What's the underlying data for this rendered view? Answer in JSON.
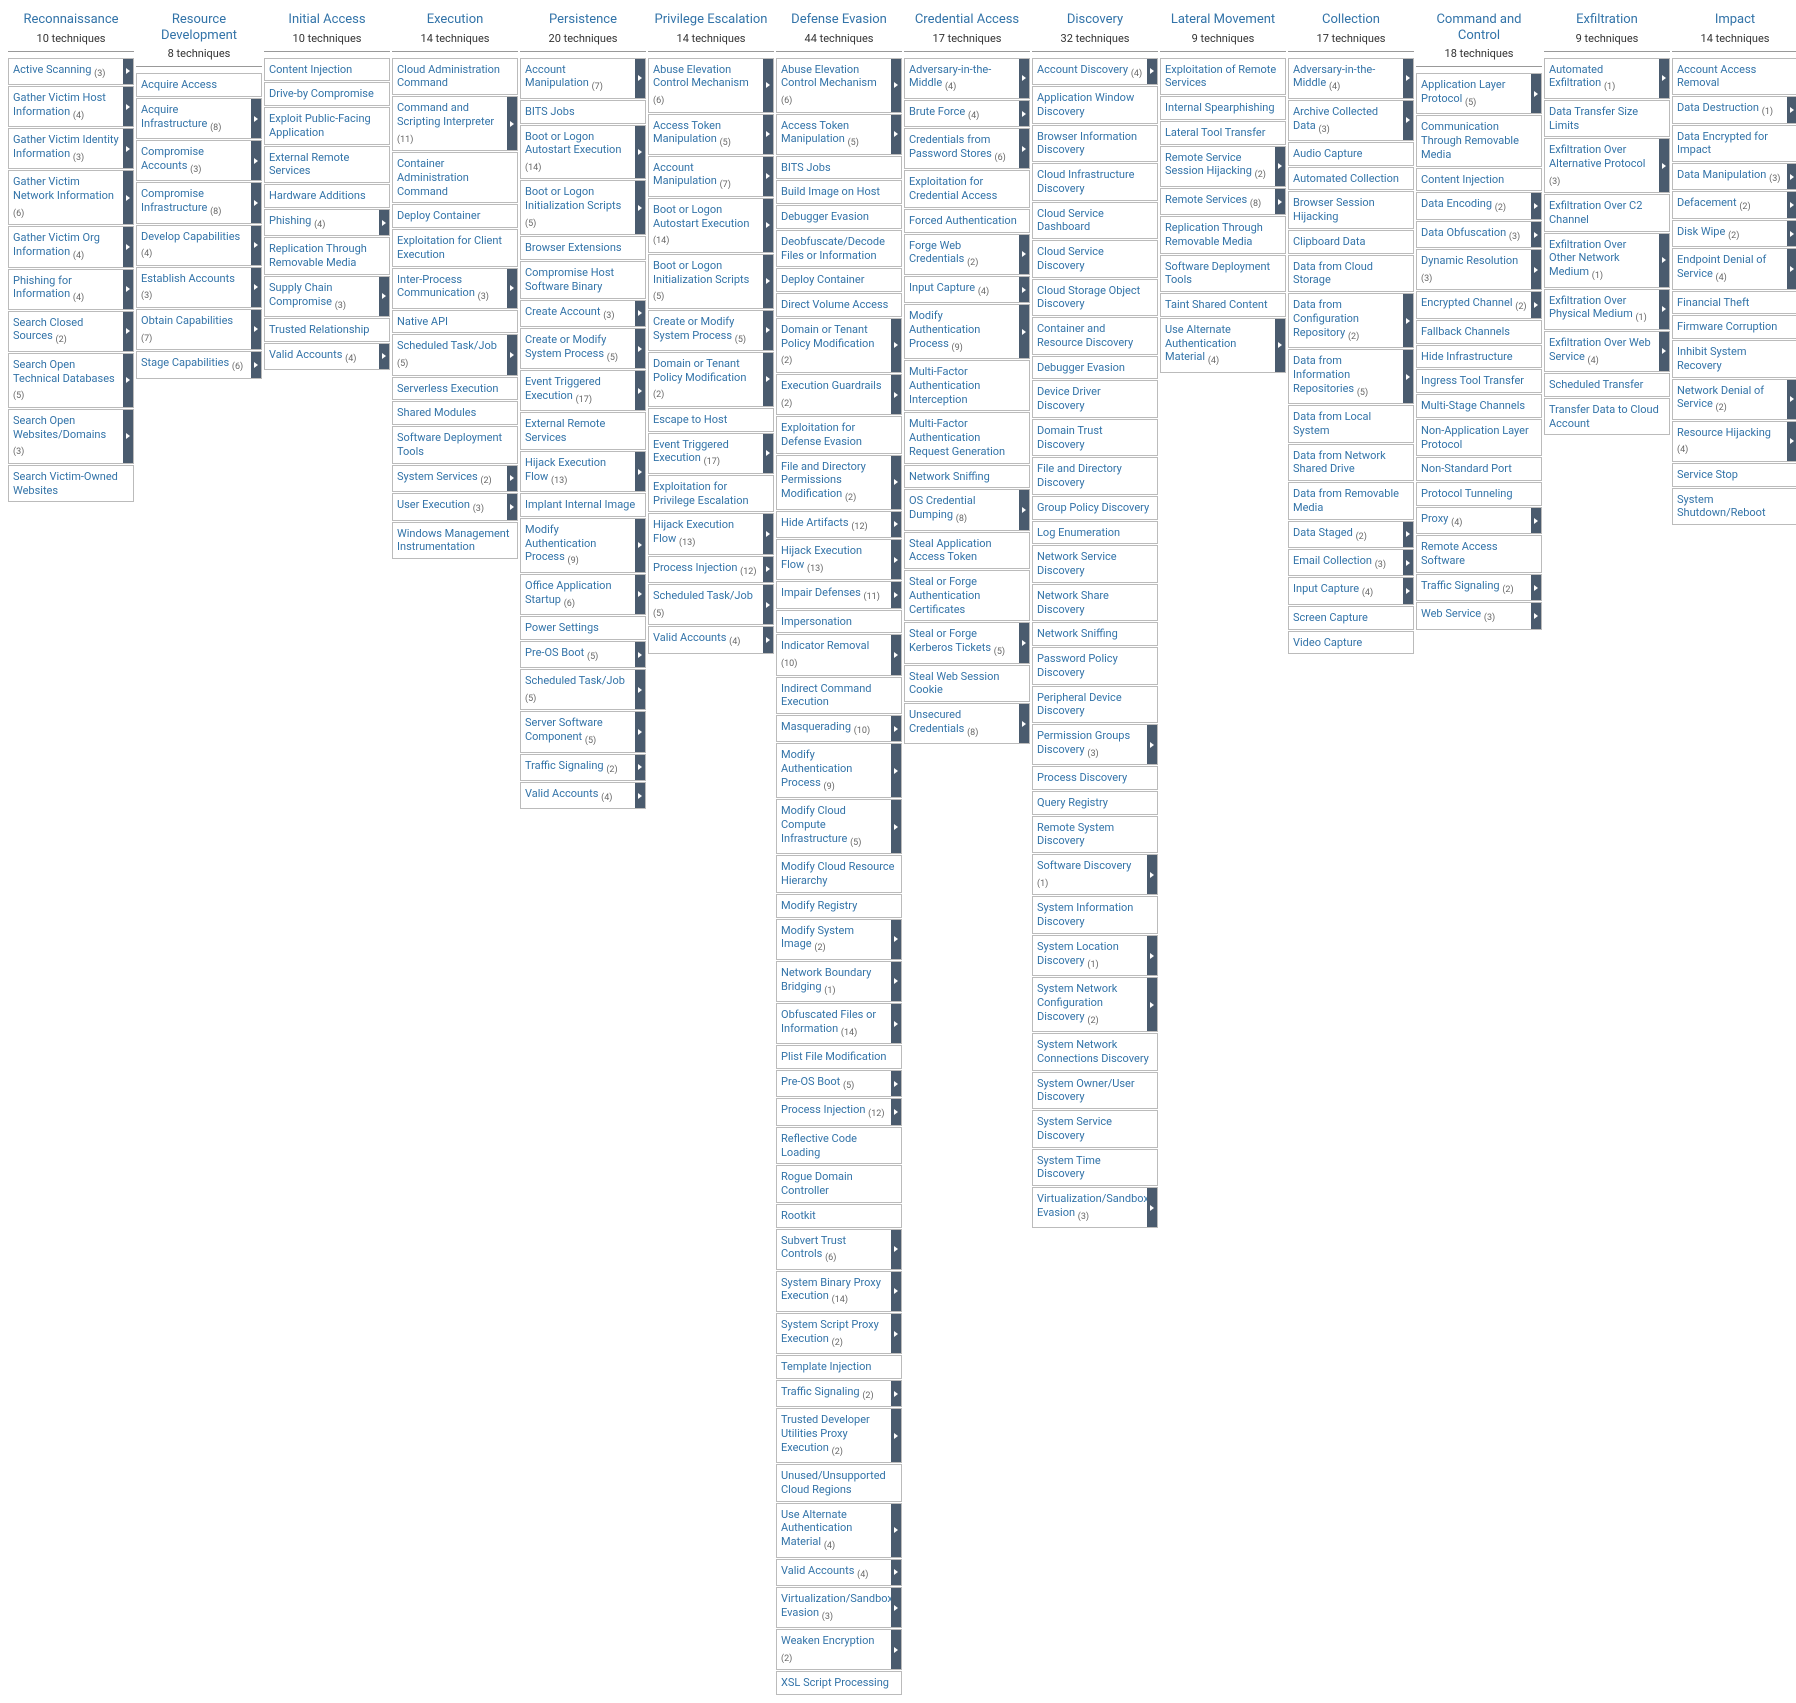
{
  "tactics": [
    {
      "name": "Reconnaissance",
      "count": "10 techniques",
      "techniques": [
        {
          "name": "Active Scanning",
          "sub": 3
        },
        {
          "name": "Gather Victim Host Information",
          "sub": 4
        },
        {
          "name": "Gather Victim Identity Information",
          "sub": 3
        },
        {
          "name": "Gather Victim Network Information",
          "sub": 6
        },
        {
          "name": "Gather Victim Org Information",
          "sub": 4
        },
        {
          "name": "Phishing for Information",
          "sub": 4
        },
        {
          "name": "Search Closed Sources",
          "sub": 2
        },
        {
          "name": "Search Open Technical Databases",
          "sub": 5
        },
        {
          "name": "Search Open Websites/Domains",
          "sub": 3
        },
        {
          "name": "Search Victim-Owned Websites"
        }
      ]
    },
    {
      "name": "Resource Development",
      "count": "8 techniques",
      "techniques": [
        {
          "name": "Acquire Access"
        },
        {
          "name": "Acquire Infrastructure",
          "sub": 8
        },
        {
          "name": "Compromise Accounts",
          "sub": 3
        },
        {
          "name": "Compromise Infrastructure",
          "sub": 8
        },
        {
          "name": "Develop Capabilities",
          "sub": 4
        },
        {
          "name": "Establish Accounts",
          "sub": 3
        },
        {
          "name": "Obtain Capabilities",
          "sub": 7
        },
        {
          "name": "Stage Capabilities",
          "sub": 6
        }
      ]
    },
    {
      "name": "Initial Access",
      "count": "10 techniques",
      "techniques": [
        {
          "name": "Content Injection"
        },
        {
          "name": "Drive-by Compromise"
        },
        {
          "name": "Exploit Public-Facing Application"
        },
        {
          "name": "External Remote Services"
        },
        {
          "name": "Hardware Additions"
        },
        {
          "name": "Phishing",
          "sub": 4
        },
        {
          "name": "Replication Through Removable Media"
        },
        {
          "name": "Supply Chain Compromise",
          "sub": 3
        },
        {
          "name": "Trusted Relationship"
        },
        {
          "name": "Valid Accounts",
          "sub": 4
        }
      ]
    },
    {
      "name": "Execution",
      "count": "14 techniques",
      "techniques": [
        {
          "name": "Cloud Administration Command"
        },
        {
          "name": "Command and Scripting Interpreter",
          "sub": 11
        },
        {
          "name": "Container Administration Command"
        },
        {
          "name": "Deploy Container"
        },
        {
          "name": "Exploitation for Client Execution"
        },
        {
          "name": "Inter-Process Communication",
          "sub": 3
        },
        {
          "name": "Native API"
        },
        {
          "name": "Scheduled Task/Job",
          "sub": 5
        },
        {
          "name": "Serverless Execution"
        },
        {
          "name": "Shared Modules"
        },
        {
          "name": "Software Deployment Tools"
        },
        {
          "name": "System Services",
          "sub": 2
        },
        {
          "name": "User Execution",
          "sub": 3
        },
        {
          "name": "Windows Management Instrumentation"
        }
      ]
    },
    {
      "name": "Persistence",
      "count": "20 techniques",
      "techniques": [
        {
          "name": "Account Manipulation",
          "sub": 7
        },
        {
          "name": "BITS Jobs"
        },
        {
          "name": "Boot or Logon Autostart Execution",
          "sub": 14
        },
        {
          "name": "Boot or Logon Initialization Scripts",
          "sub": 5
        },
        {
          "name": "Browser Extensions"
        },
        {
          "name": "Compromise Host Software Binary"
        },
        {
          "name": "Create Account",
          "sub": 3
        },
        {
          "name": "Create or Modify System Process",
          "sub": 5
        },
        {
          "name": "Event Triggered Execution",
          "sub": 17
        },
        {
          "name": "External Remote Services"
        },
        {
          "name": "Hijack Execution Flow",
          "sub": 13
        },
        {
          "name": "Implant Internal Image"
        },
        {
          "name": "Modify Authentication Process",
          "sub": 9
        },
        {
          "name": "Office Application Startup",
          "sub": 6
        },
        {
          "name": "Power Settings"
        },
        {
          "name": "Pre-OS Boot",
          "sub": 5
        },
        {
          "name": "Scheduled Task/Job",
          "sub": 5
        },
        {
          "name": "Server Software Component",
          "sub": 5
        },
        {
          "name": "Traffic Signaling",
          "sub": 2
        },
        {
          "name": "Valid Accounts",
          "sub": 4
        }
      ]
    },
    {
      "name": "Privilege Escalation",
      "count": "14 techniques",
      "techniques": [
        {
          "name": "Abuse Elevation Control Mechanism",
          "sub": 6
        },
        {
          "name": "Access Token Manipulation",
          "sub": 5
        },
        {
          "name": "Account Manipulation",
          "sub": 7
        },
        {
          "name": "Boot or Logon Autostart Execution",
          "sub": 14
        },
        {
          "name": "Boot or Logon Initialization Scripts",
          "sub": 5
        },
        {
          "name": "Create or Modify System Process",
          "sub": 5
        },
        {
          "name": "Domain or Tenant Policy Modification",
          "sub": 2
        },
        {
          "name": "Escape to Host"
        },
        {
          "name": "Event Triggered Execution",
          "sub": 17
        },
        {
          "name": "Exploitation for Privilege Escalation"
        },
        {
          "name": "Hijack Execution Flow",
          "sub": 13
        },
        {
          "name": "Process Injection",
          "sub": 12
        },
        {
          "name": "Scheduled Task/Job",
          "sub": 5
        },
        {
          "name": "Valid Accounts",
          "sub": 4
        }
      ]
    },
    {
      "name": "Defense Evasion",
      "count": "44 techniques",
      "techniques": [
        {
          "name": "Abuse Elevation Control Mechanism",
          "sub": 6
        },
        {
          "name": "Access Token Manipulation",
          "sub": 5
        },
        {
          "name": "BITS Jobs"
        },
        {
          "name": "Build Image on Host"
        },
        {
          "name": "Debugger Evasion"
        },
        {
          "name": "Deobfuscate/Decode Files or Information"
        },
        {
          "name": "Deploy Container"
        },
        {
          "name": "Direct Volume Access"
        },
        {
          "name": "Domain or Tenant Policy Modification",
          "sub": 2
        },
        {
          "name": "Execution Guardrails",
          "sub": 2
        },
        {
          "name": "Exploitation for Defense Evasion"
        },
        {
          "name": "File and Directory Permissions Modification",
          "sub": 2
        },
        {
          "name": "Hide Artifacts",
          "sub": 12
        },
        {
          "name": "Hijack Execution Flow",
          "sub": 13
        },
        {
          "name": "Impair Defenses",
          "sub": 11
        },
        {
          "name": "Impersonation"
        },
        {
          "name": "Indicator Removal",
          "sub": 10
        },
        {
          "name": "Indirect Command Execution"
        },
        {
          "name": "Masquerading",
          "sub": 10
        },
        {
          "name": "Modify Authentication Process",
          "sub": 9
        },
        {
          "name": "Modify Cloud Compute Infrastructure",
          "sub": 5
        },
        {
          "name": "Modify Cloud Resource Hierarchy"
        },
        {
          "name": "Modify Registry"
        },
        {
          "name": "Modify System Image",
          "sub": 2
        },
        {
          "name": "Network Boundary Bridging",
          "sub": 1
        },
        {
          "name": "Obfuscated Files or Information",
          "sub": 14
        },
        {
          "name": "Plist File Modification"
        },
        {
          "name": "Pre-OS Boot",
          "sub": 5
        },
        {
          "name": "Process Injection",
          "sub": 12
        },
        {
          "name": "Reflective Code Loading"
        },
        {
          "name": "Rogue Domain Controller"
        },
        {
          "name": "Rootkit"
        },
        {
          "name": "Subvert Trust Controls",
          "sub": 6
        },
        {
          "name": "System Binary Proxy Execution",
          "sub": 14
        },
        {
          "name": "System Script Proxy Execution",
          "sub": 2
        },
        {
          "name": "Template Injection"
        },
        {
          "name": "Traffic Signaling",
          "sub": 2
        },
        {
          "name": "Trusted Developer Utilities Proxy Execution",
          "sub": 2
        },
        {
          "name": "Unused/Unsupported Cloud Regions"
        },
        {
          "name": "Use Alternate Authentication Material",
          "sub": 4
        },
        {
          "name": "Valid Accounts",
          "sub": 4
        },
        {
          "name": "Virtualization/Sandbox Evasion",
          "sub": 3
        },
        {
          "name": "Weaken Encryption",
          "sub": 2
        },
        {
          "name": "XSL Script Processing"
        }
      ]
    },
    {
      "name": "Credential Access",
      "count": "17 techniques",
      "techniques": [
        {
          "name": "Adversary-in-the-Middle",
          "sub": 4
        },
        {
          "name": "Brute Force",
          "sub": 4
        },
        {
          "name": "Credentials from Password Stores",
          "sub": 6
        },
        {
          "name": "Exploitation for Credential Access"
        },
        {
          "name": "Forced Authentication"
        },
        {
          "name": "Forge Web Credentials",
          "sub": 2
        },
        {
          "name": "Input Capture",
          "sub": 4
        },
        {
          "name": "Modify Authentication Process",
          "sub": 9
        },
        {
          "name": "Multi-Factor Authentication Interception"
        },
        {
          "name": "Multi-Factor Authentication Request Generation"
        },
        {
          "name": "Network Sniffing"
        },
        {
          "name": "OS Credential Dumping",
          "sub": 8
        },
        {
          "name": "Steal Application Access Token"
        },
        {
          "name": "Steal or Forge Authentication Certificates"
        },
        {
          "name": "Steal or Forge Kerberos Tickets",
          "sub": 5
        },
        {
          "name": "Steal Web Session Cookie"
        },
        {
          "name": "Unsecured Credentials",
          "sub": 8
        }
      ]
    },
    {
      "name": "Discovery",
      "count": "32 techniques",
      "techniques": [
        {
          "name": "Account Discovery",
          "sub": 4
        },
        {
          "name": "Application Window Discovery"
        },
        {
          "name": "Browser Information Discovery"
        },
        {
          "name": "Cloud Infrastructure Discovery"
        },
        {
          "name": "Cloud Service Dashboard"
        },
        {
          "name": "Cloud Service Discovery"
        },
        {
          "name": "Cloud Storage Object Discovery"
        },
        {
          "name": "Container and Resource Discovery"
        },
        {
          "name": "Debugger Evasion"
        },
        {
          "name": "Device Driver Discovery"
        },
        {
          "name": "Domain Trust Discovery"
        },
        {
          "name": "File and Directory Discovery"
        },
        {
          "name": "Group Policy Discovery"
        },
        {
          "name": "Log Enumeration"
        },
        {
          "name": "Network Service Discovery"
        },
        {
          "name": "Network Share Discovery"
        },
        {
          "name": "Network Sniffing"
        },
        {
          "name": "Password Policy Discovery"
        },
        {
          "name": "Peripheral Device Discovery"
        },
        {
          "name": "Permission Groups Discovery",
          "sub": 3
        },
        {
          "name": "Process Discovery"
        },
        {
          "name": "Query Registry"
        },
        {
          "name": "Remote System Discovery"
        },
        {
          "name": "Software Discovery",
          "sub": 1
        },
        {
          "name": "System Information Discovery"
        },
        {
          "name": "System Location Discovery",
          "sub": 1
        },
        {
          "name": "System Network Configuration Discovery",
          "sub": 2
        },
        {
          "name": "System Network Connections Discovery"
        },
        {
          "name": "System Owner/User Discovery"
        },
        {
          "name": "System Service Discovery"
        },
        {
          "name": "System Time Discovery"
        },
        {
          "name": "Virtualization/Sandbox Evasion",
          "sub": 3
        }
      ]
    },
    {
      "name": "Lateral Movement",
      "count": "9 techniques",
      "techniques": [
        {
          "name": "Exploitation of Remote Services"
        },
        {
          "name": "Internal Spearphishing"
        },
        {
          "name": "Lateral Tool Transfer"
        },
        {
          "name": "Remote Service Session Hijacking",
          "sub": 2
        },
        {
          "name": "Remote Services",
          "sub": 8
        },
        {
          "name": "Replication Through Removable Media"
        },
        {
          "name": "Software Deployment Tools"
        },
        {
          "name": "Taint Shared Content"
        },
        {
          "name": "Use Alternate Authentication Material",
          "sub": 4
        }
      ]
    },
    {
      "name": "Collection",
      "count": "17 techniques",
      "techniques": [
        {
          "name": "Adversary-in-the-Middle",
          "sub": 4
        },
        {
          "name": "Archive Collected Data",
          "sub": 3
        },
        {
          "name": "Audio Capture"
        },
        {
          "name": "Automated Collection"
        },
        {
          "name": "Browser Session Hijacking"
        },
        {
          "name": "Clipboard Data"
        },
        {
          "name": "Data from Cloud Storage"
        },
        {
          "name": "Data from Configuration Repository",
          "sub": 2
        },
        {
          "name": "Data from Information Repositories",
          "sub": 5
        },
        {
          "name": "Data from Local System"
        },
        {
          "name": "Data from Network Shared Drive"
        },
        {
          "name": "Data from Removable Media"
        },
        {
          "name": "Data Staged",
          "sub": 2
        },
        {
          "name": "Email Collection",
          "sub": 3
        },
        {
          "name": "Input Capture",
          "sub": 4
        },
        {
          "name": "Screen Capture"
        },
        {
          "name": "Video Capture"
        }
      ]
    },
    {
      "name": "Command and Control",
      "count": "18 techniques",
      "techniques": [
        {
          "name": "Application Layer Protocol",
          "sub": 5
        },
        {
          "name": "Communication Through Removable Media"
        },
        {
          "name": "Content Injection"
        },
        {
          "name": "Data Encoding",
          "sub": 2
        },
        {
          "name": "Data Obfuscation",
          "sub": 3
        },
        {
          "name": "Dynamic Resolution",
          "sub": 3
        },
        {
          "name": "Encrypted Channel",
          "sub": 2
        },
        {
          "name": "Fallback Channels"
        },
        {
          "name": "Hide Infrastructure"
        },
        {
          "name": "Ingress Tool Transfer"
        },
        {
          "name": "Multi-Stage Channels"
        },
        {
          "name": "Non-Application Layer Protocol"
        },
        {
          "name": "Non-Standard Port"
        },
        {
          "name": "Protocol Tunneling"
        },
        {
          "name": "Proxy",
          "sub": 4
        },
        {
          "name": "Remote Access Software"
        },
        {
          "name": "Traffic Signaling",
          "sub": 2
        },
        {
          "name": "Web Service",
          "sub": 3
        }
      ]
    },
    {
      "name": "Exfiltration",
      "count": "9 techniques",
      "techniques": [
        {
          "name": "Automated Exfiltration",
          "sub": 1
        },
        {
          "name": "Data Transfer Size Limits"
        },
        {
          "name": "Exfiltration Over Alternative Protocol",
          "sub": 3
        },
        {
          "name": "Exfiltration Over C2 Channel"
        },
        {
          "name": "Exfiltration Over Other Network Medium",
          "sub": 1
        },
        {
          "name": "Exfiltration Over Physical Medium",
          "sub": 1
        },
        {
          "name": "Exfiltration Over Web Service",
          "sub": 4
        },
        {
          "name": "Scheduled Transfer"
        },
        {
          "name": "Transfer Data to Cloud Account"
        }
      ]
    },
    {
      "name": "Impact",
      "count": "14 techniques",
      "techniques": [
        {
          "name": "Account Access Removal"
        },
        {
          "name": "Data Destruction",
          "sub": 1
        },
        {
          "name": "Data Encrypted for Impact"
        },
        {
          "name": "Data Manipulation",
          "sub": 3
        },
        {
          "name": "Defacement",
          "sub": 2
        },
        {
          "name": "Disk Wipe",
          "sub": 2
        },
        {
          "name": "Endpoint Denial of Service",
          "sub": 4
        },
        {
          "name": "Financial Theft"
        },
        {
          "name": "Firmware Corruption"
        },
        {
          "name": "Inhibit System Recovery"
        },
        {
          "name": "Network Denial of Service",
          "sub": 2
        },
        {
          "name": "Resource Hijacking",
          "sub": 4
        },
        {
          "name": "Service Stop"
        },
        {
          "name": "System Shutdown/Reboot"
        }
      ]
    }
  ]
}
